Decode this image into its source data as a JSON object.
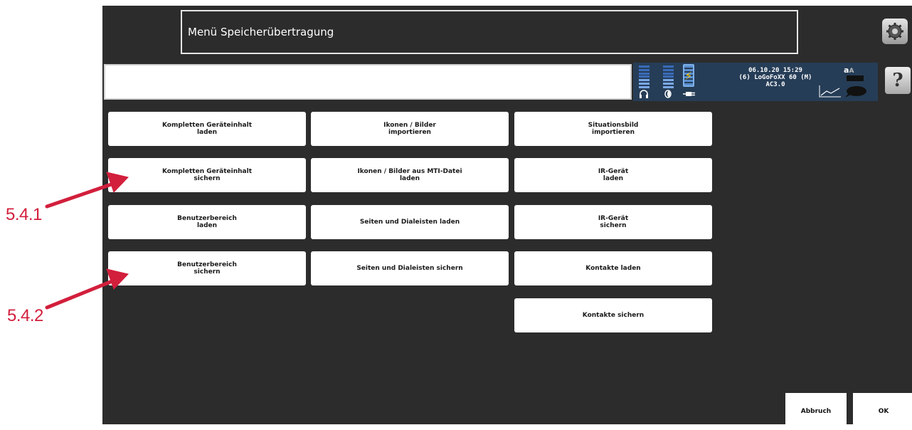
{
  "header": {
    "title": "Menü Speicherübertragung"
  },
  "status": {
    "datetime": "06.10.20 15:29",
    "device": "(6) LoGoFoXX 60 (M) AC3.0",
    "text_size_icon": "a",
    "text_size_small": "A"
  },
  "icons": {
    "settings": "gear-icon",
    "help": "?"
  },
  "grid": {
    "col1": [
      "Kompletten Geräteinhalt\nladen",
      "Kompletten Geräteinhalt\nsichern",
      "Benutzerbereich\nladen",
      "Benutzerbereich\nsichern"
    ],
    "col2": [
      "Ikonen / Bilder\nimportieren",
      "Ikonen / Bilder aus MTI-Datei\nladen",
      "Seiten und Dialeisten laden",
      "Seiten und Dialeisten sichern"
    ],
    "col3": [
      "Situationsbild\nimportieren",
      "IR-Gerät\nladen",
      "IR-Gerät\nsichern",
      "Kontakte laden",
      "Kontakte sichern"
    ]
  },
  "actions": {
    "cancel": "Abbruch",
    "ok": "OK"
  },
  "annotations": {
    "a1": "5.4.1",
    "a2": "5.4.2"
  },
  "colors": {
    "background": "#2c2c2c",
    "status_bar": "#263d57",
    "annotation": "#d21f3c"
  }
}
